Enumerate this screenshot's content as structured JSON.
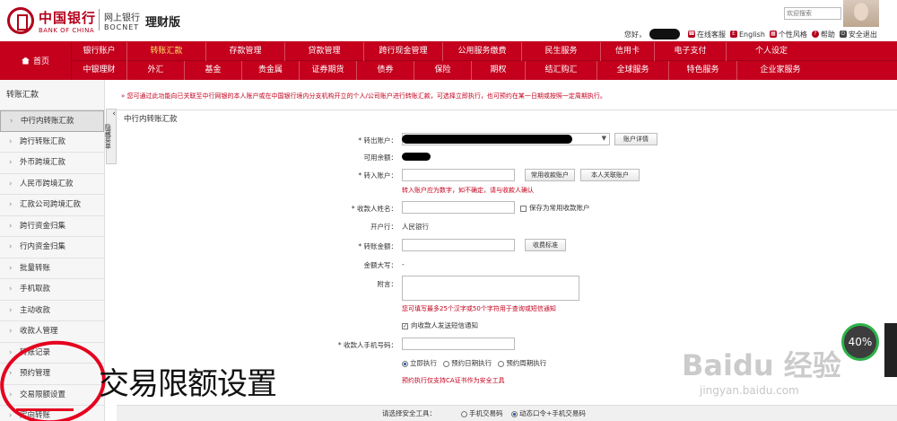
{
  "header": {
    "logo_cn": "中国银行",
    "logo_en": "BANK OF CHINA",
    "brand_cn": "网上银行",
    "brand_en": "BOCNET",
    "edition": "理财版",
    "search_placeholder": "欢迎搜索",
    "greeting": "您好，",
    "toolbar": {
      "online_service": "在线客服",
      "english": "English",
      "personal_style": "个性风格",
      "help": "帮助",
      "safe_exit": "安全退出"
    }
  },
  "nav": {
    "home": "首页",
    "row1": [
      "银行账户",
      "转账汇款",
      "存款管理",
      "贷款管理",
      "跨行现金管理",
      "公用服务缴费",
      "民生服务",
      "信用卡",
      "电子支付",
      "个人设定"
    ],
    "row2": [
      "中银理财",
      "外汇",
      "基金",
      "贵金属",
      "证券期货",
      "债券",
      "保险",
      "期权",
      "结汇购汇",
      "全球服务",
      "特色服务",
      "企业家服务"
    ],
    "active": "转账汇款"
  },
  "sidebar": {
    "title": "转账汇款",
    "items": [
      "中行内转账汇款",
      "跨行转账汇款",
      "外币跨境汇款",
      "人民币跨境汇款",
      "汇款公司跨境汇款",
      "跨行资金归集",
      "行内资金归集",
      "批量转账",
      "手机取款",
      "主动收款",
      "收款人管理",
      "转账记录",
      "预约管理",
      "交易限额设置",
      "定向转账"
    ],
    "collapse_label": "隐藏菜单"
  },
  "notice": "您可通过此功能向已关联至中行网银的本人账户或在中国银行境内分支机构开立的个人/公司账户进行转账汇款，可选择立即执行，也可预约在某一日期或按照一定周期执行。",
  "form": {
    "title": "中行内转账汇款",
    "from_account_label": "转出账户：",
    "account_detail_btn": "账户详情",
    "balance_label": "可用余额：",
    "to_account_label": "转入账户：",
    "frequent_payee_btn": "常用收款账户",
    "own_linked_btn": "本人关联账户",
    "to_account_error": "转入账户应为数字，如不确定，请与收款人确认",
    "payee_name_label": "收款人姓名：",
    "save_frequent_label": "保存为常用收款账户",
    "bank_label": "开户行：",
    "bank_value": "人民银行",
    "amount_label": "转账金额：",
    "fee_standard_btn": "收费标准",
    "amount_upper_label": "金额大写：",
    "amount_upper_value": "-",
    "remark_label": "附言：",
    "remark_hint": "您可填写最多25个汉字或50个字符用于查询或短信通知",
    "sms_notify_label": "向收款人发送短信通知",
    "phone_label": "收款人手机号码：",
    "exec_options": [
      "立即执行",
      "预约日期执行",
      "预约周期执行"
    ],
    "exec_hint": "预约执行仅支持CA证书作为安全工具",
    "security_label": "请选择安全工具：",
    "security_options": [
      "手机交易码",
      "动态口令+手机交易码"
    ]
  },
  "overlay": {
    "caption": "交易限额设置",
    "progress": "40%",
    "watermark": "Baidu 经验",
    "watermark_url": "jingyan.baidu.com"
  },
  "colors": {
    "brand_red": "#c4001d",
    "active_nav_text": "#ffe066",
    "annotation_red": "#e5001e"
  }
}
